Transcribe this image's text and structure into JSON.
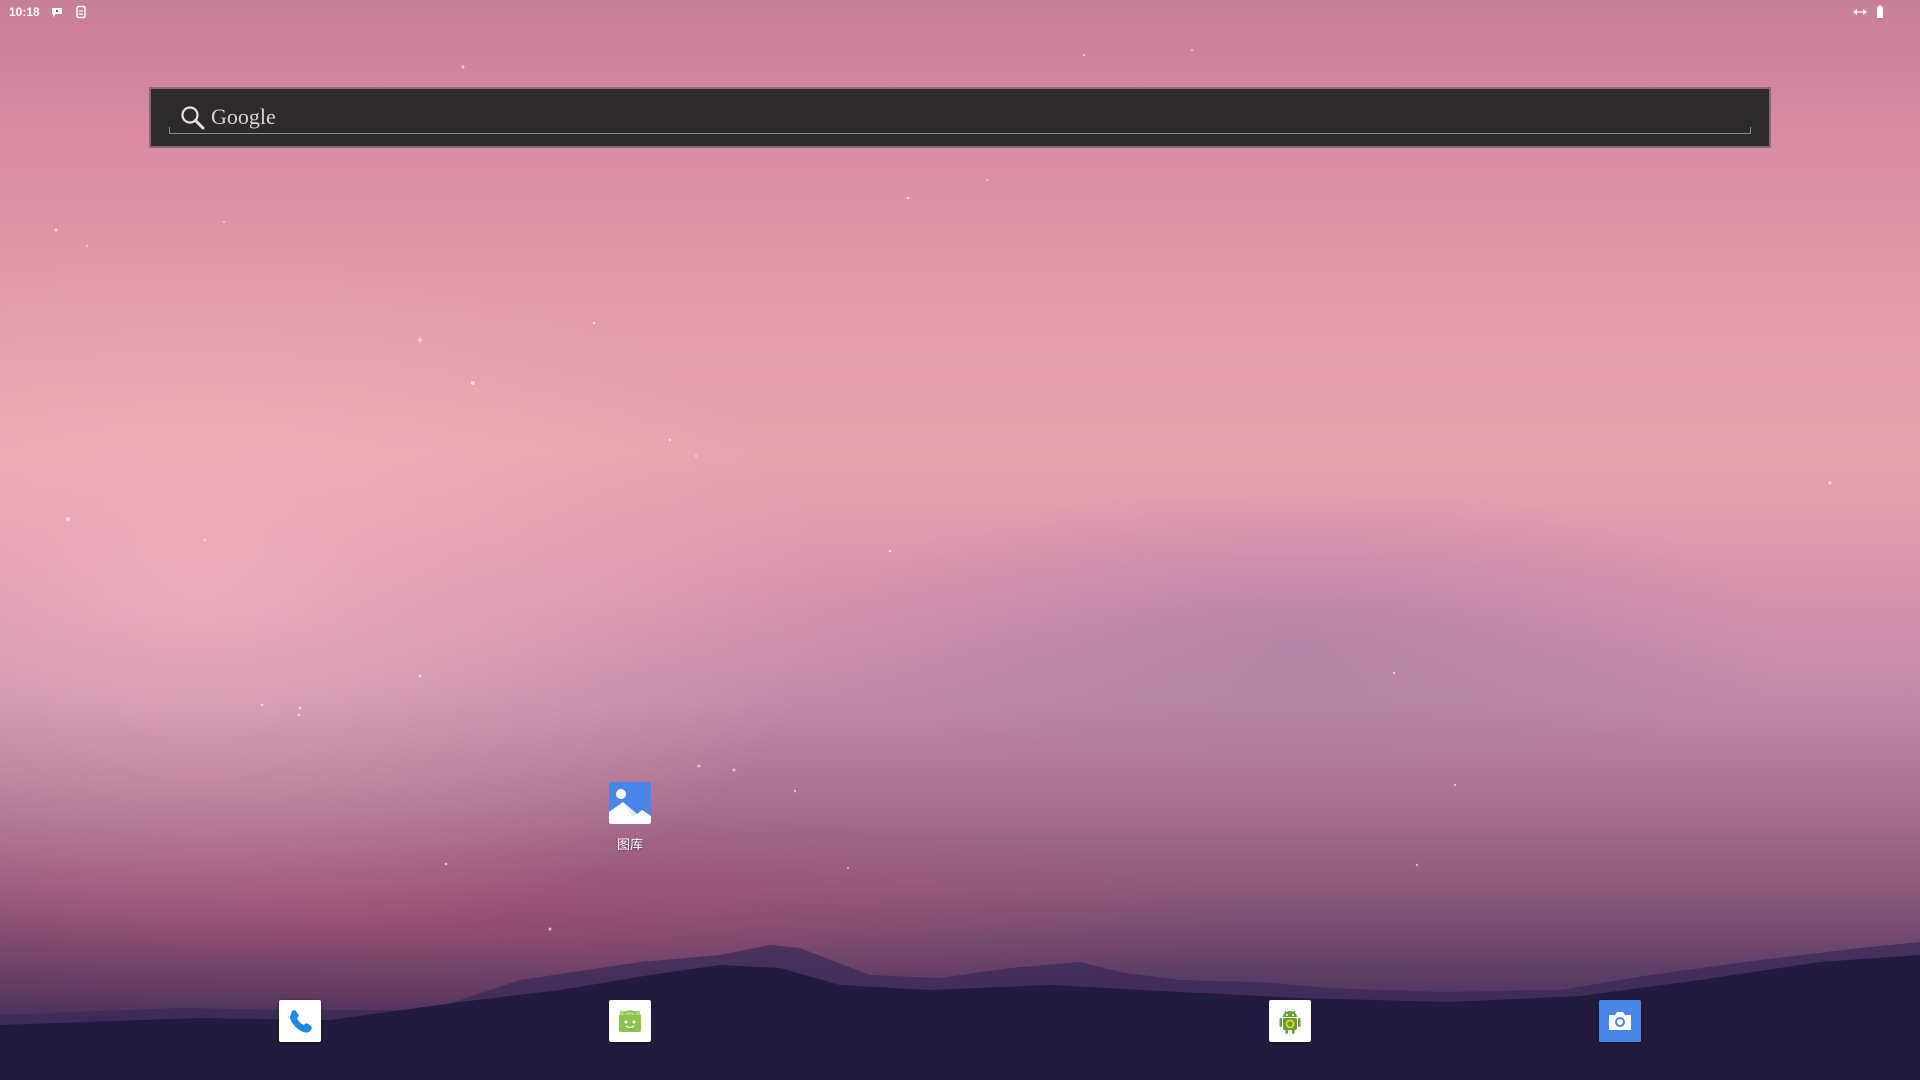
{
  "status_bar": {
    "time": "10:18",
    "left_icons": [
      "notification-bubble-icon",
      "sim-card-icon"
    ],
    "right_icons": [
      "data-transfer-icon",
      "battery-icon"
    ]
  },
  "search": {
    "label": "Google",
    "icon": "search-icon"
  },
  "desktop": {
    "apps": [
      {
        "label": "图库",
        "icon": "gallery-icon",
        "accent": "#4a86e8"
      }
    ]
  },
  "dock": {
    "items": [
      {
        "icon": "phone-icon",
        "accent": "#1e88e5"
      },
      {
        "icon": "app-store-icon",
        "accent": "#8bc34a"
      },
      {
        "icon": "android-icon",
        "accent": "#689f38"
      },
      {
        "icon": "camera-icon",
        "accent": "#4a86e8"
      }
    ]
  },
  "colors": {
    "wallpaper_top": "#c77e97",
    "wallpaper_mid": "#e9a2b0",
    "wallpaper_bottom": "#2a2246",
    "search_bg": "#2d2a2b"
  }
}
